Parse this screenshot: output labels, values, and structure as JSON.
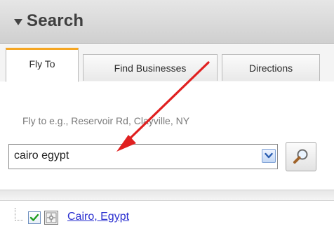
{
  "header": {
    "title": "Search",
    "collapse_icon": "triangle-down-icon"
  },
  "tabs": [
    {
      "label": "Fly To",
      "active": true
    },
    {
      "label": "Find Businesses",
      "active": false
    },
    {
      "label": "Directions",
      "active": false
    }
  ],
  "fly_to": {
    "hint": "Fly to e.g., Reservoir Rd, Clayville, NY",
    "input_value": "cairo egypt",
    "dropdown_icon": "chevron-down-icon",
    "search_icon": "magnifier-icon"
  },
  "results": [
    {
      "label": "Cairo, Egypt",
      "checked": true,
      "icon": "placemark-crosshair-icon"
    }
  ],
  "annotation": {
    "color": "#e02020"
  }
}
